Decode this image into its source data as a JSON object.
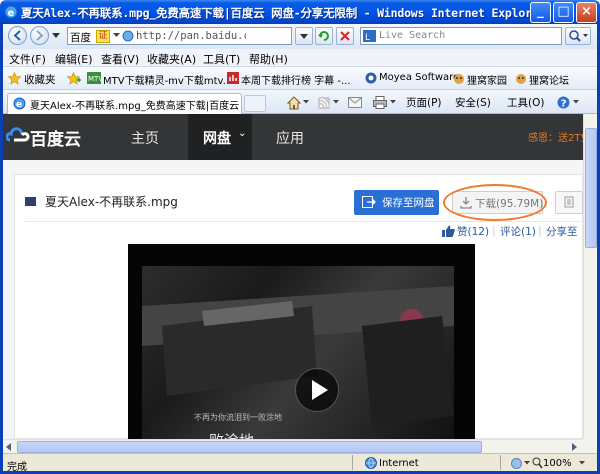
{
  "window": {
    "title": "夏天Alex-不再联系.mpg_免费高速下载|百度云 网盘-分享无限制 - Windows Internet Explorer",
    "controls": [
      "_",
      "□",
      "×"
    ]
  },
  "address": {
    "site_label": "百度",
    "cert_label": "证",
    "url": "http://pan.baidu.com/share/li",
    "search_placeholder": "Live Search"
  },
  "menu": [
    "文件(F)",
    "编辑(E)",
    "查看(V)",
    "收藏夹(A)",
    "工具(T)",
    "帮助(H)"
  ],
  "favorites": {
    "label": "收藏夹",
    "items": [
      "MTV下载精灵-mv下载mtv...",
      "本周下载排行榜 字幕 -...",
      "Moyea Software",
      "狸窝家园",
      "狸窝论坛"
    ]
  },
  "tab": {
    "title": "夏天Alex-不再联系.mpg_免费高速下载|百度云..."
  },
  "commands": [
    "页面(P)",
    "安全(S)",
    "工具(O)"
  ],
  "site": {
    "logo": "百度云",
    "nav": [
      "主页",
      "网盘",
      "应用"
    ],
    "promo": "感恩：送2T免"
  },
  "file": {
    "name": "夏天Alex-不再联系.mpg",
    "save_label": "保存至网盘",
    "download_label": "下载(95.79M)"
  },
  "social": {
    "like": "赞(12)",
    "comment": "评论(1)",
    "share": "分享至"
  },
  "video": {
    "subtitle_small": "不再为你流泪到一败涂地",
    "subtitle_big": "一败涂地"
  },
  "status": {
    "text": "完成",
    "zone": "Internet",
    "zoom": "100%"
  }
}
